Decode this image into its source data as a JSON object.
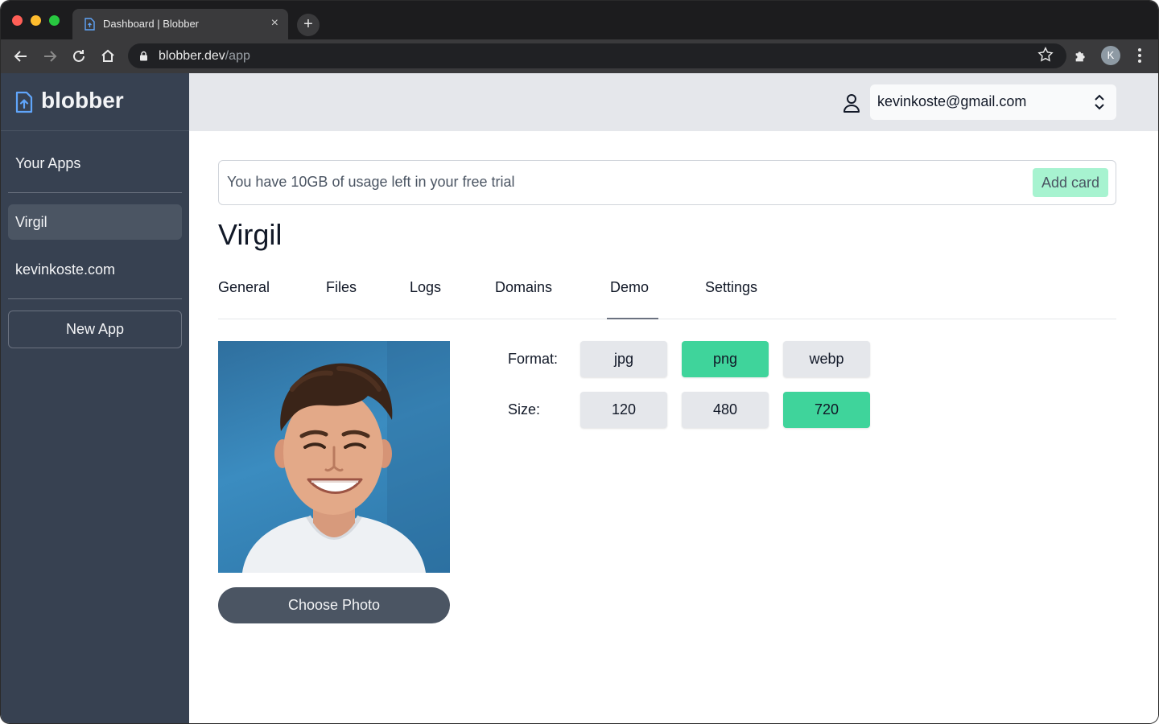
{
  "browser": {
    "tab_title": "Dashboard | Blobber",
    "tab_close": "×",
    "new_tab": "+",
    "url_host": "blobber.dev",
    "url_path": "/app",
    "profile_initial": "K"
  },
  "sidebar": {
    "brand": "blobber",
    "heading": "Your Apps",
    "apps": [
      {
        "label": "Virgil",
        "active": true
      },
      {
        "label": "kevinkoste.com",
        "active": false
      }
    ],
    "new_app_label": "New App"
  },
  "topbar": {
    "account": "kevinkoste@gmail.com"
  },
  "banner": {
    "text": "You have 10GB of usage left in your free trial",
    "add_card_label": "Add card"
  },
  "app": {
    "title": "Virgil",
    "tabs": [
      "General",
      "Files",
      "Logs",
      "Domains",
      "Demo",
      "Settings"
    ],
    "active_tab": "Demo"
  },
  "demo": {
    "choose_photo_label": "Choose Photo",
    "format_label": "Format:",
    "formats": [
      "jpg",
      "png",
      "webp"
    ],
    "selected_format": "png",
    "size_label": "Size:",
    "sizes": [
      "120",
      "480",
      "720"
    ],
    "selected_size": "720"
  },
  "colors": {
    "sidebar_bg": "#374151",
    "selected_option": "#3fd49b",
    "add_card_bg": "#a7f3d0",
    "brand_icon": "#60a5fa"
  }
}
